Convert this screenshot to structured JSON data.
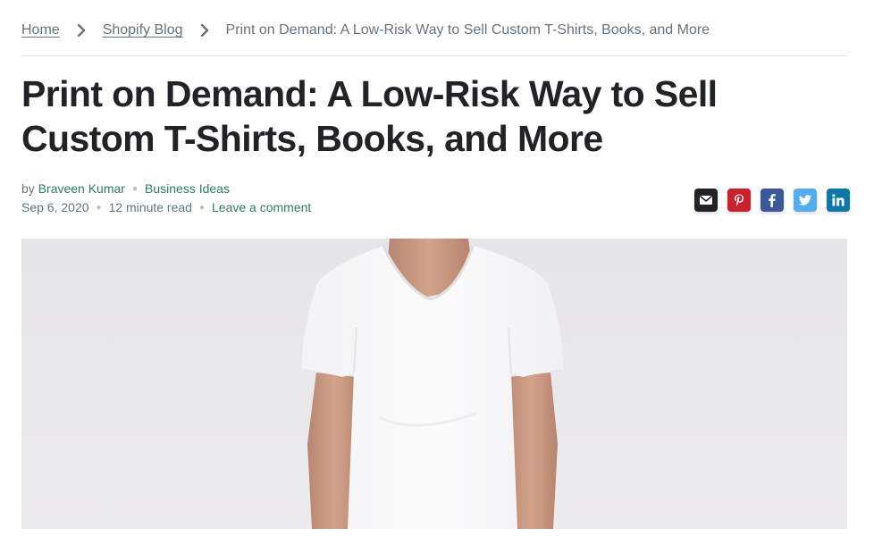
{
  "breadcrumb": {
    "home": "Home",
    "blog": "Shopify Blog",
    "current": "Print on Demand: A Low-Risk Way to Sell Custom T-Shirts, Books, and More"
  },
  "article": {
    "title": "Print on Demand: A Low-Risk Way to Sell Custom T-Shirts, Books, and More",
    "by_label": "by",
    "author": "Braveen Kumar",
    "category": "Business Ideas",
    "date": "Sep 6, 2020",
    "read_time": "12 minute read",
    "comment_link": "Leave a comment"
  },
  "share": {
    "buttons": [
      {
        "name": "email",
        "icon": "envelope-icon",
        "color": "#212326"
      },
      {
        "name": "pinterest",
        "icon": "pinterest-icon",
        "color": "#c8232c"
      },
      {
        "name": "facebook",
        "icon": "facebook-icon",
        "color": "#3b5998"
      },
      {
        "name": "twitter",
        "icon": "twitter-icon",
        "color": "#55acee"
      },
      {
        "name": "linkedin",
        "icon": "linkedin-icon",
        "color": "#0e76a8"
      }
    ]
  },
  "hero": {
    "subject": "person wearing a plain white v-neck t-shirt"
  }
}
